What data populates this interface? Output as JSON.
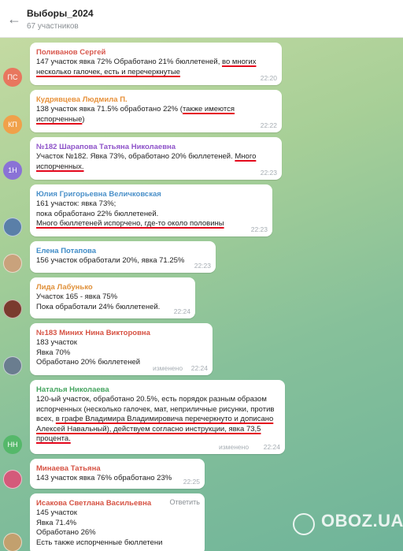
{
  "header": {
    "back_icon": "arrow-left-icon",
    "title": "Выборы_2024",
    "subtitle": "67 участников"
  },
  "messages": [
    {
      "avatar": "ПС",
      "avatar_color": "#e8775f",
      "name": "Поливанов Сергей",
      "name_color": "#d8584e",
      "text_plain": "147 участок явка 72% Обработано 21% бюллетеней, ",
      "text_underlined": "во многих несколько галочек, есть и перечеркнутые",
      "time": "22:20"
    },
    {
      "avatar": "КП",
      "avatar_color": "#f0a14a",
      "name": "Кудрявцева Людмила П.",
      "name_color": "#e7913a",
      "text_plain": "138 участок явка 71.5% обработано 22% (",
      "text_underlined": "также имеются испорченные",
      "text_after": ")",
      "time": "22:22"
    },
    {
      "avatar": "1Н",
      "avatar_color": "#8a72d6",
      "name": "№182 Шарапова Татьяна Николаевна",
      "name_color": "#8e53c9",
      "text_plain": "Участок №182. Явка 73%, обработано 20% бюллетеней. ",
      "text_underlined": "Много испорченных.",
      "time": "22:23"
    },
    {
      "avatar": "",
      "avatar_color": "#5a7fa8",
      "name": "Юлия Григорьевна Величковская",
      "name_color": "#4a90c9",
      "text_plain": "161 участок: явка 73%;\nпока обработано 22% бюллетеней.\n",
      "text_underlined": "Много бюллетеней испорчено, где-то около половины",
      "time": "22:23"
    },
    {
      "avatar": "",
      "avatar_color": "#c9a27c",
      "name": "Елена Потапова",
      "name_color": "#3f8cc7",
      "text_plain": "156 участок обработали 20%, явка 71.25%",
      "time": "22:23"
    },
    {
      "avatar": "",
      "avatar_color": "#7a3b2e",
      "name": "Лида Лабунько",
      "name_color": "#e0913b",
      "text_plain": "Участок 165 - явка 75%\nПока обработали 24% бюллетеней.",
      "time": "22:24"
    },
    {
      "avatar": "",
      "avatar_color": "#6a7d8f",
      "name": "№183 Миних Нина Викторовна",
      "name_color": "#d65243",
      "text_plain": "183 участок\nЯвка 70%\nОбработано 20% бюллетеней",
      "edited": "изменено",
      "time": "22:24"
    },
    {
      "avatar": "НН",
      "avatar_color": "#55b86a",
      "name": "Наталья Николаева",
      "name_color": "#45a45f",
      "text_plain": "120-ый участок, обработано 20.5%, есть порядок разным образом испорченных (несколько галочек, мат, неприличные рисунки, против всех, ",
      "text_underlined": "в графе Владимира Владимировича перечеркнуто и дописано Алексей Навальный), действуем согласно инструкции, явка 73,5 процента.",
      "edited": "изменено",
      "time": "22:24"
    },
    {
      "avatar": "",
      "avatar_color": "#d45a7a",
      "name": "Минаева Татьяна",
      "name_color": "#d65243",
      "text_plain": "143 участок явка 76% обработано 23%",
      "time": "22:25"
    },
    {
      "avatar": "",
      "avatar_color": "#c2a06e",
      "name": "Исакова Светлана Васильевна",
      "name_color": "#d65243",
      "reply": "Ответить",
      "text_plain": "145 участок\nЯвка 71.4%\nОбработано 26%\nЕсть также испорченные бюллетени",
      "time": ""
    }
  ],
  "watermark": "OBOZ.UA"
}
